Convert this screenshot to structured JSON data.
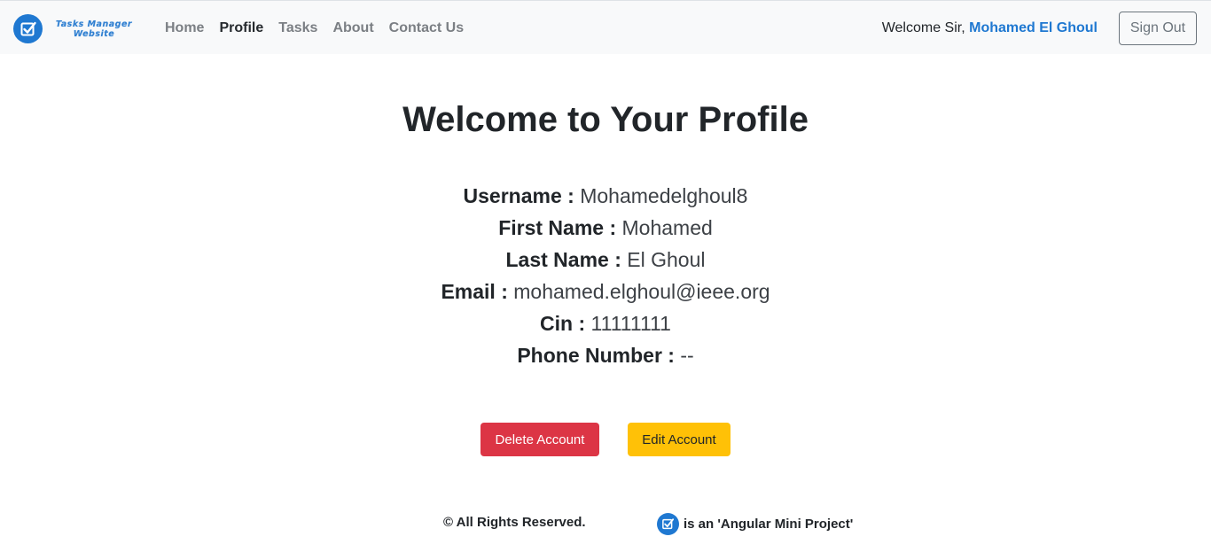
{
  "brand": {
    "line1": "Tasks Manager",
    "line2": "Website",
    "icon": "checkbox-icon",
    "color": "#1f78d1"
  },
  "nav": {
    "items": [
      {
        "label": "Home",
        "active": false
      },
      {
        "label": "Profile",
        "active": true
      },
      {
        "label": "Tasks",
        "active": false
      },
      {
        "label": "About",
        "active": false
      },
      {
        "label": "Contact Us",
        "active": false
      }
    ]
  },
  "header": {
    "welcome_prefix": "Welcome Sir,",
    "user_name": "Mohamed El Ghoul",
    "sign_out_label": "Sign Out"
  },
  "profile": {
    "title": "Welcome to Your Profile",
    "fields": [
      {
        "label": "Username :",
        "value": "Mohamedelghoul8"
      },
      {
        "label": "First Name :",
        "value": "Mohamed"
      },
      {
        "label": "Last Name :",
        "value": "El Ghoul"
      },
      {
        "label": "Email :",
        "value": "mohamed.elghoul@ieee.org"
      },
      {
        "label": "Cin :",
        "value": "11111111"
      },
      {
        "label": "Phone Number :",
        "value": "--"
      }
    ]
  },
  "actions": {
    "delete_label": "Delete Account",
    "edit_label": "Edit Account",
    "delete_color": "#dc3545",
    "edit_color": "#ffc107"
  },
  "footer": {
    "rights": "© All Rights Reserved.",
    "project_note": "is an 'Angular Mini Project'"
  }
}
